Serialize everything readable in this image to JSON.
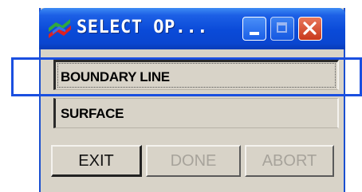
{
  "window": {
    "title": "SELECT OP...",
    "icon": "app-logo-icon",
    "controls": {
      "minimize": "minimize-icon",
      "maximize": "maximize-icon",
      "close": "close-icon"
    },
    "colors": {
      "titlebar": "#0a4ad8",
      "close": "#c8391c",
      "highlight": "#1a4fe0",
      "body": "#d8d3c8"
    }
  },
  "options": [
    {
      "label": "BOUNDARY LINE",
      "focused": true
    },
    {
      "label": "SURFACE",
      "focused": false
    }
  ],
  "buttons": {
    "exit": {
      "label": "EXIT",
      "enabled": true
    },
    "done": {
      "label": "DONE",
      "enabled": false
    },
    "abort": {
      "label": "ABORT",
      "enabled": false
    }
  }
}
